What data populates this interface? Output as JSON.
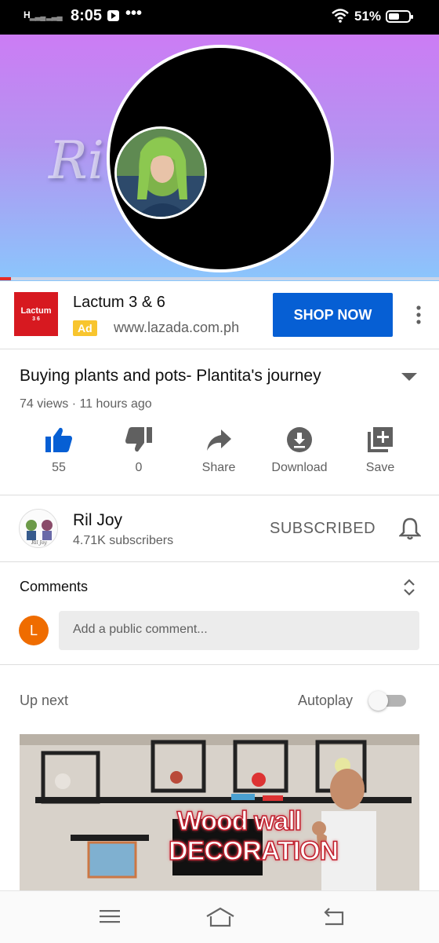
{
  "status_bar": {
    "time": "8:05",
    "signal": "H",
    "battery": "51%",
    "overflow_dots": "•••"
  },
  "player": {
    "watermark": "Ri",
    "progress": 0.025,
    "gradient_top": "#cc7cf4",
    "gradient_bottom": "#8ac6fc"
  },
  "ad": {
    "logo_text": "Lactum",
    "logo_sub": "3 6",
    "title": "Lactum 3 & 6",
    "badge": "Ad",
    "url": "www.lazada.com.ph",
    "cta": "SHOP NOW",
    "cta_color": "#065fd4"
  },
  "video": {
    "title": "Buying plants and pots- Plantita's journey",
    "meta": "74 views · 11 hours ago",
    "actions": [
      {
        "label": "55",
        "icon": "thumbs-up-icon"
      },
      {
        "label": "0",
        "icon": "thumbs-down-icon"
      },
      {
        "label": "Share",
        "icon": "share-icon"
      },
      {
        "label": "Download",
        "icon": "download-icon"
      },
      {
        "label": "Save",
        "icon": "save-playlist-icon"
      }
    ]
  },
  "channel": {
    "name": "Ril Joy",
    "subscribers": "4.71K subscribers",
    "subscribe_state": "SUBSCRIBED"
  },
  "comments": {
    "label": "Comments",
    "user_initial": "L",
    "placeholder": "Add a public comment..."
  },
  "up_next": {
    "label": "Up next",
    "autoplay_label": "Autoplay",
    "autoplay_on": false,
    "thumb_text": "Wood wall DECORATION"
  }
}
